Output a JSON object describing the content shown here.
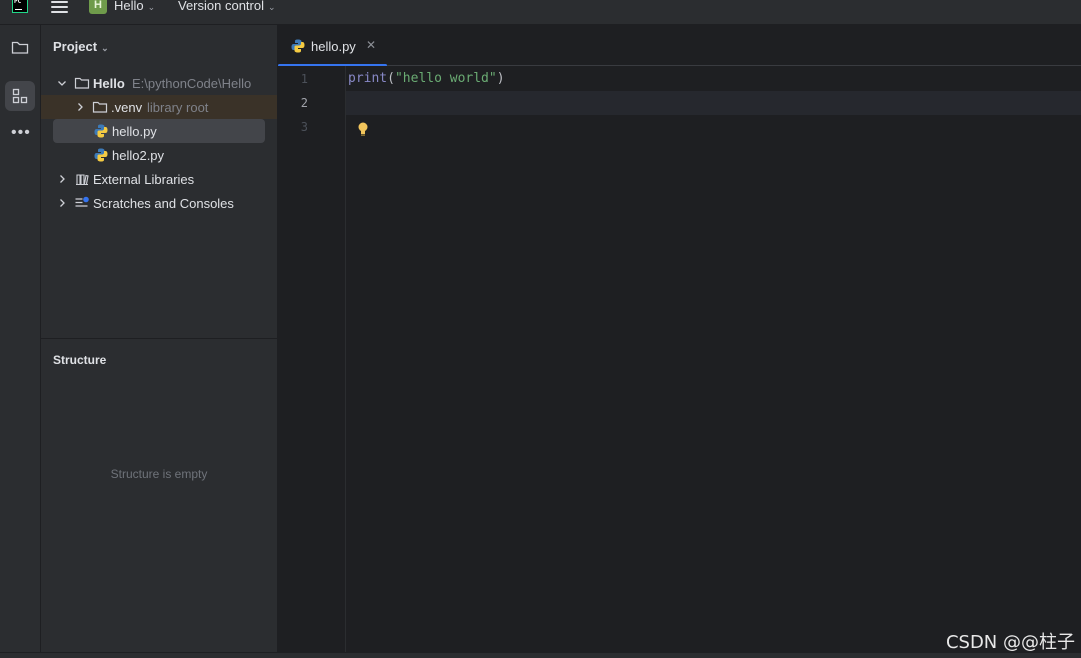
{
  "titlebar": {
    "app_logo": "PC",
    "project_badge": "H",
    "project_name": "Hello",
    "vcs_label": "Version control",
    "icons": [
      "pycharm-logo-icon",
      "hamburger-menu-icon",
      "chevron-down-icon"
    ]
  },
  "activity_bar": {
    "items": [
      {
        "name": "project-folder-icon",
        "active": false
      },
      {
        "name": "structure-icon",
        "active": true
      },
      {
        "name": "more-icon",
        "active": false
      }
    ]
  },
  "project_panel": {
    "title": "Project",
    "tree": [
      {
        "label": "Hello",
        "hint": "E:\\pythonCode\\Hello",
        "icon": "folder-icon",
        "expanded": true
      },
      {
        "label": ".venv",
        "hint": "library root",
        "icon": "folder-icon",
        "expanded": false
      },
      {
        "label": "hello.py",
        "icon": "python-file-icon",
        "selected": true
      },
      {
        "label": "hello2.py",
        "icon": "python-file-icon"
      },
      {
        "label": "External Libraries",
        "icon": "libraries-icon",
        "expanded": false
      },
      {
        "label": "Scratches and Consoles",
        "icon": "scratches-icon",
        "expanded": false
      }
    ]
  },
  "structure_panel": {
    "title": "Structure",
    "empty_text": "Structure is empty"
  },
  "editor": {
    "tab": {
      "label": "hello.py",
      "close": "✕",
      "icon": "python-file-icon"
    },
    "line_numbers": [
      "1",
      "2",
      "3"
    ],
    "current_line": 2,
    "code": {
      "fn": "print",
      "open": "(",
      "str": "\"hello world\"",
      "close": ")"
    }
  },
  "watermark": "CSDN @@柱子",
  "colors": {
    "accent": "#3574f0",
    "panel_bg": "#2b2d30",
    "editor_bg": "#1e1f22",
    "string": "#6aab73",
    "builtin": "#8888c6"
  }
}
